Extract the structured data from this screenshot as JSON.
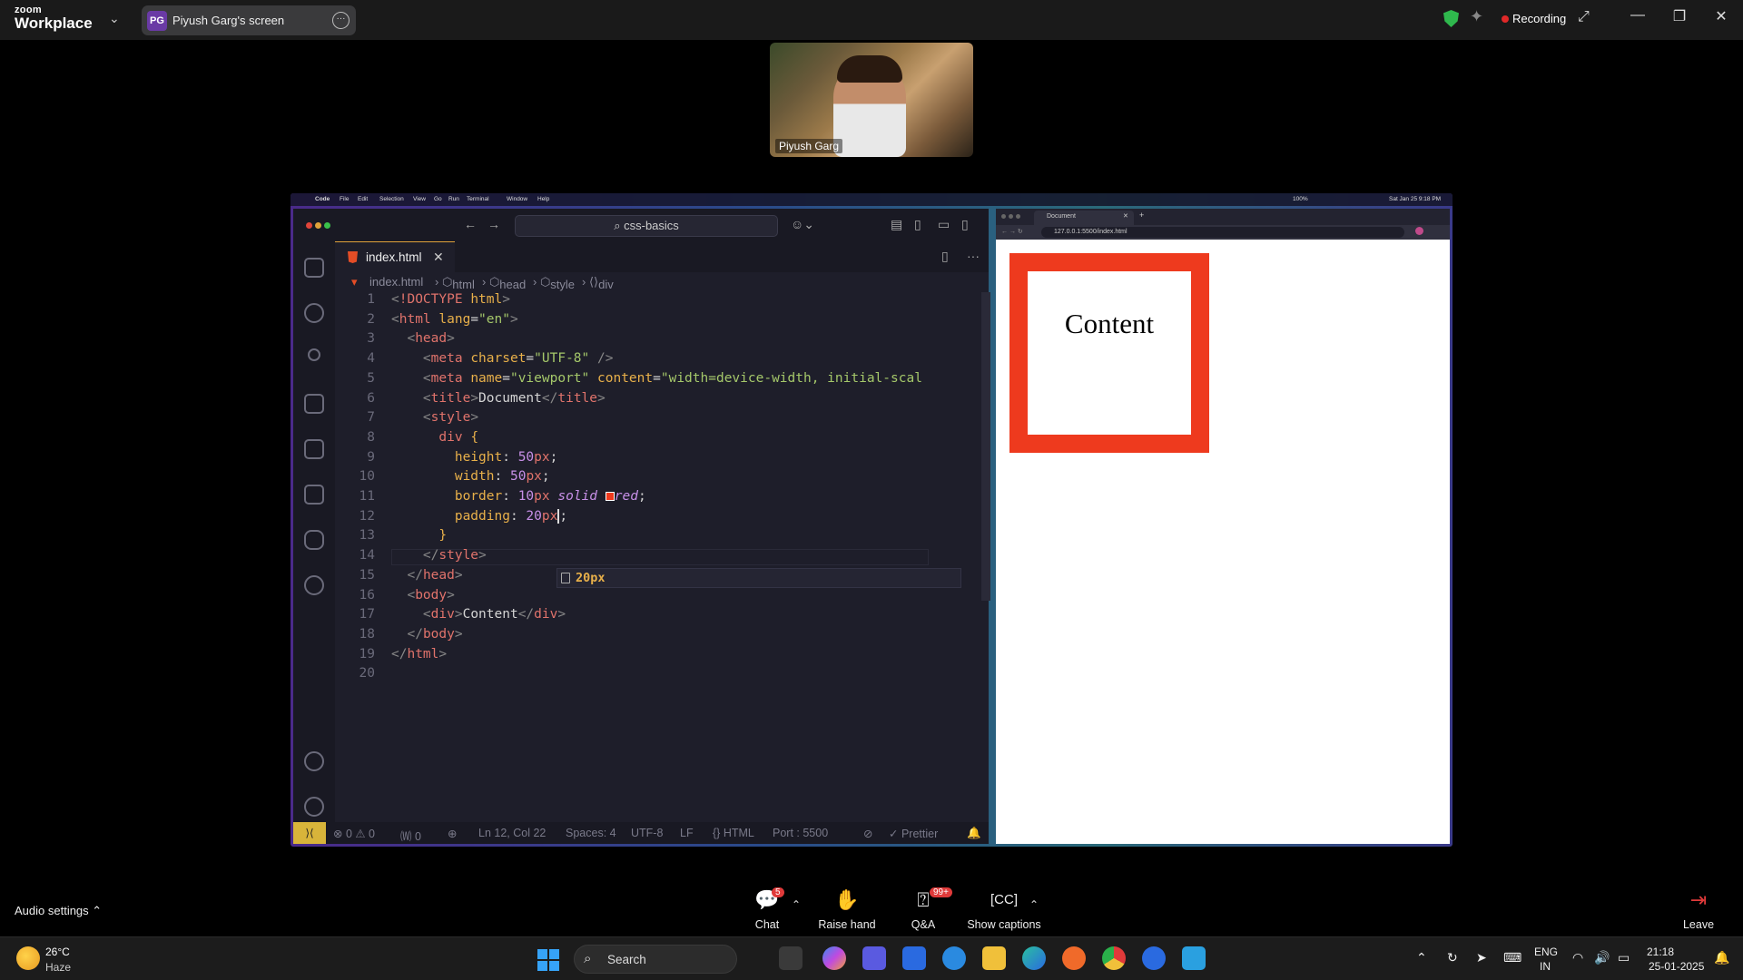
{
  "zoom": {
    "logo_small": "zoom",
    "logo_big": "Workplace",
    "share_initials": "PG",
    "share_title": "Piyush Garg's screen",
    "recording_label": "Recording",
    "participant_name": "Piyush Garg",
    "audio_settings": "Audio settings",
    "controls": [
      {
        "label": "Chat",
        "icon": "chat-icon",
        "badge": "5"
      },
      {
        "label": "Raise hand",
        "icon": "hand-icon"
      },
      {
        "label": "Q&A",
        "icon": "qa-icon",
        "badge": "99+"
      },
      {
        "label": "Show captions",
        "icon": "cc-icon"
      }
    ],
    "leave_label": "Leave",
    "accent_recording": "#e02828"
  },
  "mac_menubar": {
    "app": "Code",
    "items": [
      "File",
      "Edit",
      "Selection",
      "View",
      "Go",
      "Run",
      "Terminal",
      "Window",
      "Help"
    ],
    "datetime": "Sat Jan 25  9:18 PM",
    "battery": "100%"
  },
  "vscode": {
    "search": "css-basics",
    "tab": "index.html",
    "breadcrumb": [
      "index.html",
      "html",
      "head",
      "style",
      "div"
    ],
    "lines": [
      "1",
      "2",
      "3",
      "4",
      "5",
      "6",
      "7",
      "8",
      "9",
      "10",
      "11",
      "12",
      "13",
      "14",
      "15",
      "16",
      "17",
      "18",
      "19",
      "20"
    ],
    "suggestion": "20px",
    "status": {
      "problems": "⊗ 0 ⚠ 0",
      "ports": "🄦 0",
      "position": "Ln 12, Col 22",
      "spaces": "Spaces: 4",
      "encoding": "UTF-8",
      "eol": "LF",
      "language": "{} HTML",
      "port": "Port : 5500",
      "formatter": "✓ Prettier"
    }
  },
  "browser": {
    "tab_title": "Document",
    "url": "127.0.0.1:5500/index.html",
    "div_content": "Content",
    "border_color": "#ee3a1e"
  },
  "taskbar": {
    "temp": "26°C",
    "condition": "Haze",
    "search": "Search",
    "lang": "ENG",
    "region": "IN",
    "time": "21:18",
    "date": "25-01-2025"
  }
}
